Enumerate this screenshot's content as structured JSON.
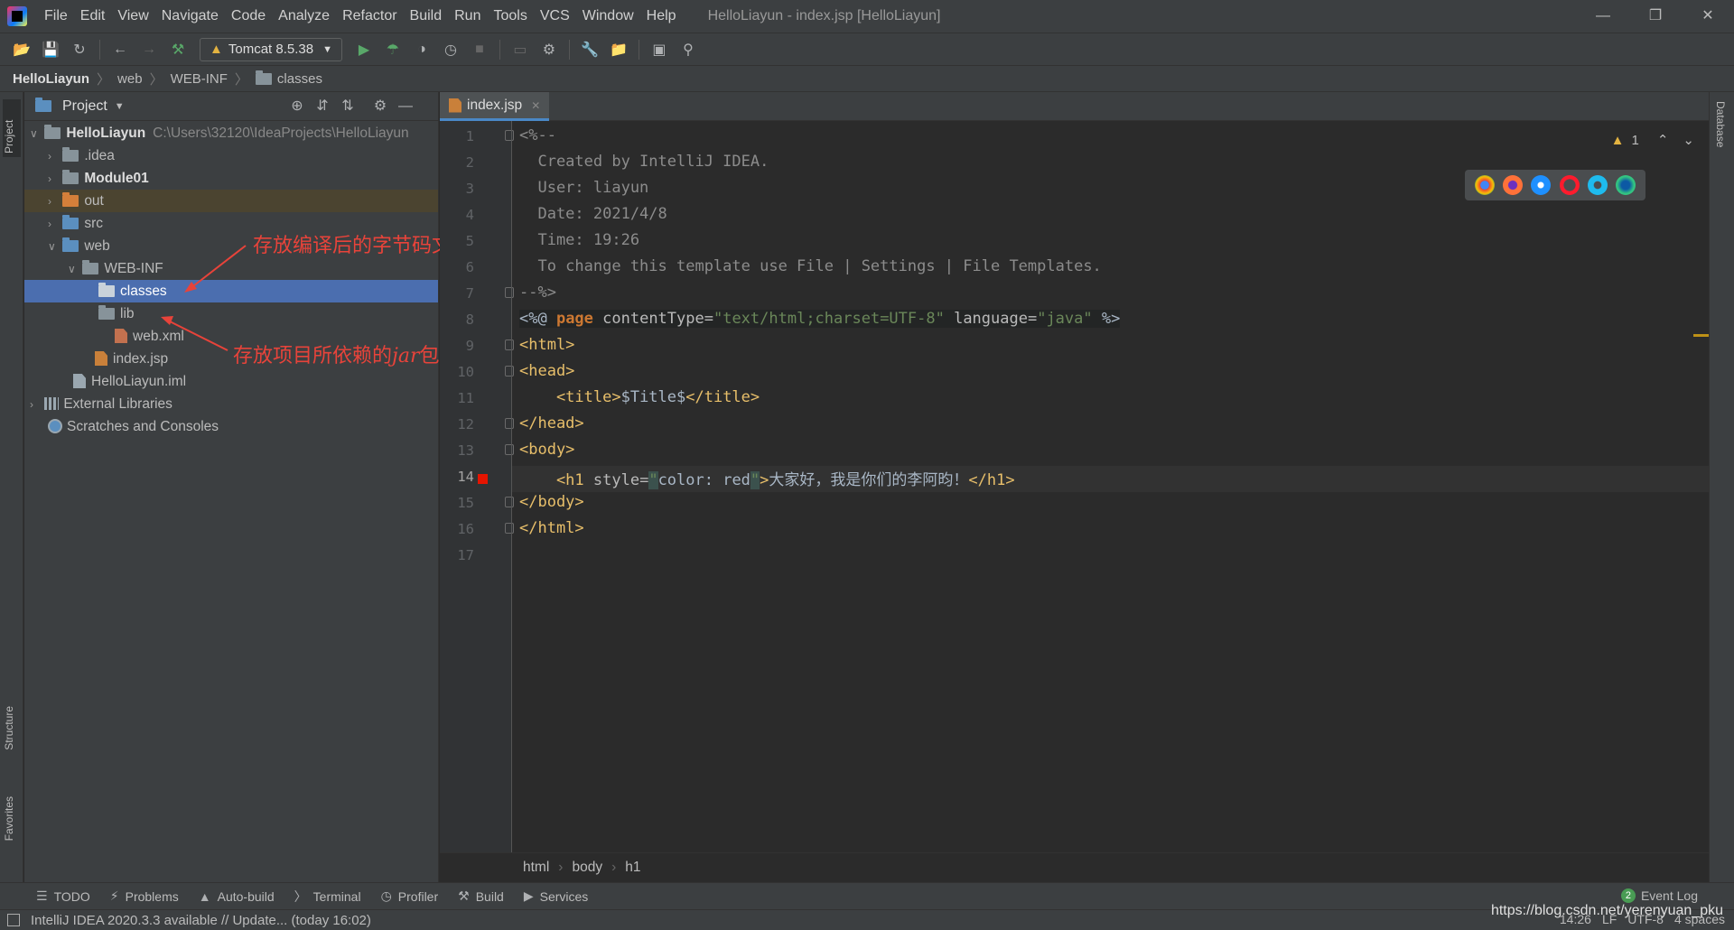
{
  "menubar": {
    "items": [
      "File",
      "Edit",
      "View",
      "Navigate",
      "Code",
      "Analyze",
      "Refactor",
      "Build",
      "Run",
      "Tools",
      "VCS",
      "Window",
      "Help"
    ],
    "window_title": "HelloLiayun - index.jsp [HelloLiayun]"
  },
  "toolbar": {
    "run_config": "Tomcat 8.5.38"
  },
  "navbar": {
    "crumbs": [
      "HelloLiayun",
      "web",
      "WEB-INF",
      "classes"
    ]
  },
  "left_stripe": {
    "project": "Project",
    "structure": "Structure",
    "favorites": "Favorites"
  },
  "right_stripe": {
    "database": "Database"
  },
  "project_panel": {
    "title": "Project",
    "tree": [
      {
        "label": "HelloLiayun",
        "path": "C:\\Users\\32120\\IdeaProjects\\HelloLiayun"
      },
      {
        "label": ".idea"
      },
      {
        "label": "Module01"
      },
      {
        "label": "out"
      },
      {
        "label": "src"
      },
      {
        "label": "web"
      },
      {
        "label": "WEB-INF"
      },
      {
        "label": "classes"
      },
      {
        "label": "lib"
      },
      {
        "label": "web.xml"
      },
      {
        "label": "index.jsp"
      },
      {
        "label": "HelloLiayun.iml"
      },
      {
        "label": "External Libraries"
      },
      {
        "label": "Scratches and Consoles"
      }
    ]
  },
  "annotations": {
    "classes_note": "存放编译后的字节码文件",
    "lib_note_prefix": "存放项目所依赖的",
    "lib_note_jar": "jar",
    "lib_note_suffix": "包"
  },
  "editor": {
    "tab_label": "index.jsp",
    "warning_count": "1",
    "line_numbers": [
      "1",
      "2",
      "3",
      "4",
      "5",
      "6",
      "7",
      "8",
      "9",
      "10",
      "11",
      "12",
      "13",
      "14",
      "15",
      "16",
      "17"
    ],
    "lines": {
      "l1": "<%--",
      "l2": "  Created by IntelliJ IDEA.",
      "l3": "  User: liayun",
      "l4": "  Date: 2021/4/8",
      "l5": "  Time: 19:26",
      "l6": "  To change this template use File | Settings | File Templates.",
      "l7": "--%>",
      "l8_open": "<%@ ",
      "l8_kw": "page",
      "l8_attr1": " contentType=",
      "l8_val1": "\"text/html;charset=UTF-8\"",
      "l8_attr2": " language=",
      "l8_val2": "\"java\"",
      "l8_close": " %>",
      "l9": "<html>",
      "l10": "<head>",
      "l11_open": "    <title>",
      "l11_text": "$Title$",
      "l11_close": "</title>",
      "l12": "</head>",
      "l13": "<body>",
      "l14_open": "    <h1 ",
      "l14_attr": "style=",
      "l14_q1": "\"",
      "l14_val": "color: red",
      "l14_q2": "\"",
      "l14_gt": ">",
      "l14_text": "大家好，我是你们的李阿昀！",
      "l14_close": "</h1>",
      "l15": "</body>",
      "l16": "</html>"
    },
    "crumbs": [
      "html",
      "body",
      "h1"
    ]
  },
  "tool_windows": [
    "TODO",
    "Problems",
    "Auto-build",
    "Terminal",
    "Profiler",
    "Build",
    "Services"
  ],
  "event_log": {
    "label": "Event Log",
    "count": "2"
  },
  "status": {
    "message": "IntelliJ IDEA 2020.3.3 available // Update... (today 16:02)",
    "position": "14:26",
    "line_sep": "LF",
    "encoding": "UTF-8",
    "indent": "4 spaces"
  },
  "watermark": "https://blog.csdn.net/yerenyuan_pku",
  "colors": {
    "accent": "#4b6eaf",
    "annotation": "#e8433a",
    "tag": "#e8bf6a",
    "string": "#6a8759",
    "keyword": "#cc7832"
  }
}
